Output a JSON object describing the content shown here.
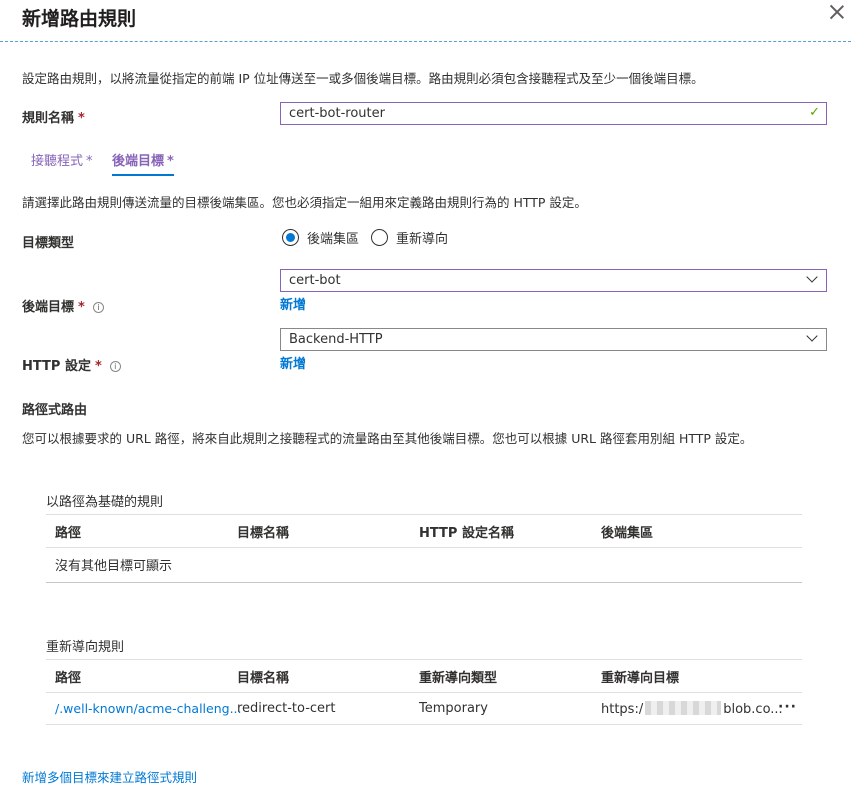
{
  "header": {
    "title": "新增路由規則"
  },
  "intro": "設定路由規則，以將流量從指定的前端 IP 位址傳送至一或多個後端目標。路由規則必須包含接聽程式及至少一個後端目標。",
  "rule_name": {
    "label": "規則名稱",
    "required_mark": "*",
    "value": "cert-bot-router"
  },
  "tabs": [
    {
      "label": "接聽程式",
      "required_mark": "*",
      "active": false
    },
    {
      "label": "後端目標",
      "required_mark": "*",
      "active": true
    }
  ],
  "backend_desc": "請選擇此路由規則傳送流量的目標後端集區。您也必須指定一組用來定義路由規則行為的 HTTP 設定。",
  "target_type": {
    "label": "目標類型",
    "options": [
      {
        "label": "後端集區",
        "selected": true
      },
      {
        "label": "重新導向",
        "selected": false
      }
    ]
  },
  "backend_target": {
    "label": "後端目標",
    "required_mark": "*",
    "value": "cert-bot",
    "add_label": "新增"
  },
  "http_setting": {
    "label": "HTTP 設定",
    "required_mark": "*",
    "value": "Backend-HTTP",
    "add_label": "新增"
  },
  "path_routing": {
    "heading": "路徑式路由",
    "desc": "您可以根據要求的 URL 路徑，將來自此規則之接聽程式的流量路由至其他後端目標。您也可以根據 URL 路徑套用別組 HTTP 設定。"
  },
  "path_rules": {
    "title": "以路徑為基礎的規則",
    "columns": [
      "路徑",
      "目標名稱",
      "HTTP 設定名稱",
      "後端集區"
    ],
    "empty_text": "沒有其他目標可顯示"
  },
  "redirect_rules": {
    "title": "重新導向規則",
    "columns": [
      "路徑",
      "目標名稱",
      "重新導向類型",
      "重新導向目標"
    ],
    "rows": [
      {
        "path": "/.well-known/acme-challeng...",
        "target_name": "redirect-to-cert",
        "redirect_type": "Temporary",
        "target_prefix": "https:/",
        "target_suffix": "blob.co...",
        "more": "···"
      }
    ]
  },
  "footer_link": "新增多個目標來建立路徑式規則"
}
